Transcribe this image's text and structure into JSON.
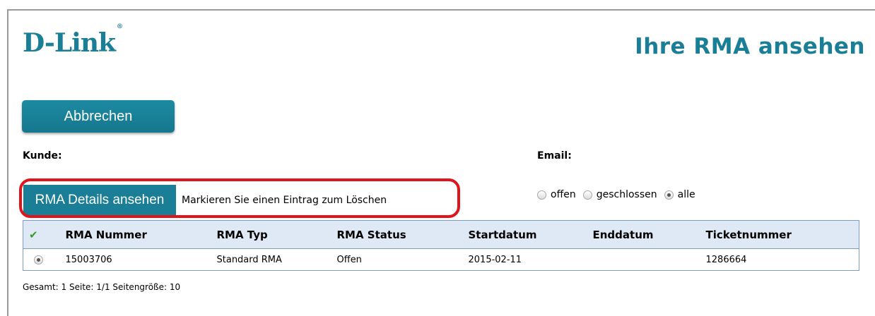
{
  "header": {
    "logo_text": "D-Link",
    "logo_mark": "®",
    "title": "Ihre RMA ansehen"
  },
  "actions": {
    "cancel_label": "Abbrechen",
    "details_label": "RMA Details ansehen",
    "delete_hint": "Markieren Sie einen Eintrag zum Löschen"
  },
  "fields": {
    "customer_label": "Kunde:",
    "email_label": "Email:"
  },
  "filters": {
    "options": [
      "offen",
      "geschlossen",
      "alle"
    ],
    "selected": "alle"
  },
  "table": {
    "columns": [
      "RMA Nummer",
      "RMA Typ",
      "RMA Status",
      "Startdatum",
      "Enddatum",
      "Ticketnummer"
    ],
    "rows": [
      {
        "rma_nummer": "15003706",
        "rma_typ": "Standard RMA",
        "rma_status": "Offen",
        "startdatum": "2015-02-11",
        "enddatum": "",
        "ticketnummer": "1286664"
      }
    ]
  },
  "footer": {
    "summary": "Gesamt: 1 Seite: 1/1 Seitengröße: 10"
  },
  "colors": {
    "brand": "#1a7f96",
    "highlight": "#e0151b",
    "table_header": "#dfe9f5"
  }
}
